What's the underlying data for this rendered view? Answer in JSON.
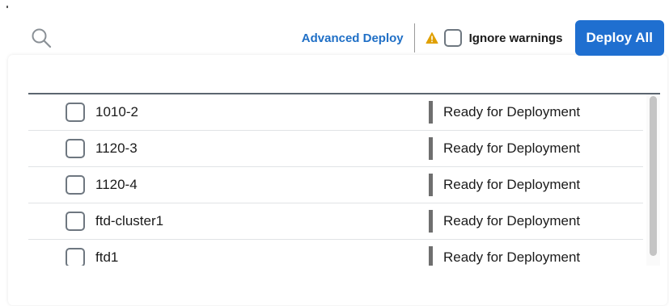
{
  "toolbar": {
    "advanced_deploy_label": "Advanced Deploy",
    "ignore_warnings_label": "Ignore warnings",
    "deploy_all_label": "Deploy All",
    "ignore_warnings_checked": false
  },
  "icons": {
    "search": "search-icon",
    "warning": "warning-icon"
  },
  "colors": {
    "accent": "#1f6fd0",
    "link": "#1f6fc6",
    "warning": "#e0a000",
    "status_bar": "#6f6f6f"
  },
  "devices": [
    {
      "name": "1010-2",
      "status": "Ready for Deployment",
      "checked": false
    },
    {
      "name": "1120-3",
      "status": "Ready for Deployment",
      "checked": false
    },
    {
      "name": "1120-4",
      "status": "Ready for Deployment",
      "checked": false
    },
    {
      "name": "ftd-cluster1",
      "status": "Ready for Deployment",
      "checked": false
    },
    {
      "name": "ftd1",
      "status": "Ready for Deployment",
      "checked": false
    }
  ]
}
